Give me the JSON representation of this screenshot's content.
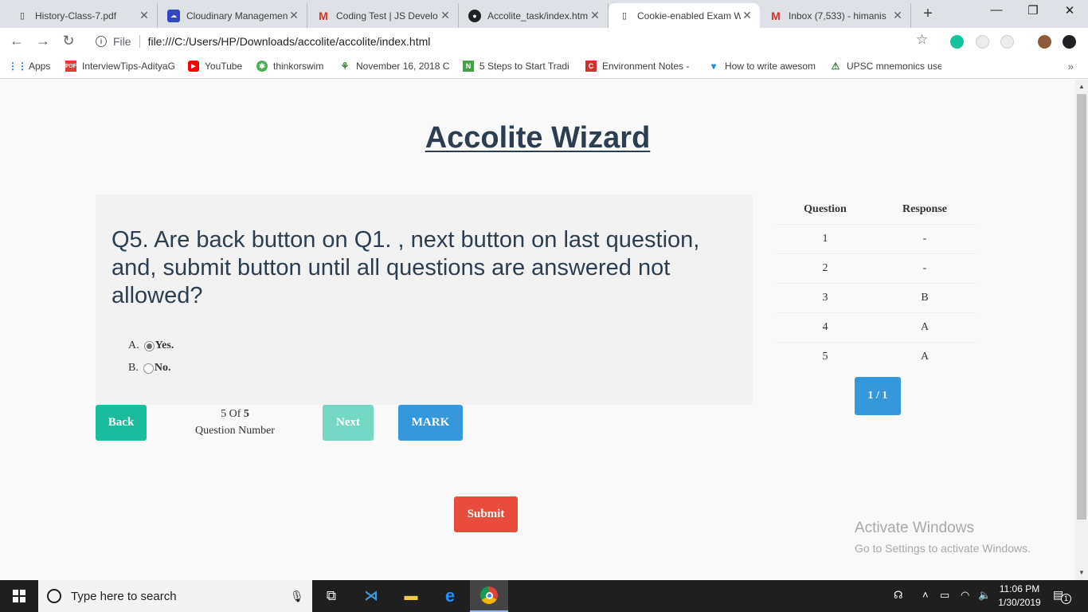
{
  "browser": {
    "tabs": [
      {
        "title": "History-Class-7.pdf",
        "icon": "document-icon"
      },
      {
        "title": "Cloudinary Managemen",
        "icon": "cloudinary-icon"
      },
      {
        "title": "Coding Test | JS Develo",
        "icon": "gmail-icon"
      },
      {
        "title": "Accolite_task/index.htm",
        "icon": "github-icon"
      },
      {
        "title": "Cookie-enabled Exam W",
        "icon": "document-icon"
      },
      {
        "title": "Inbox (7,533) - himanis",
        "icon": "gmail-icon"
      }
    ],
    "scheme": "File",
    "url": "file:///C:/Users/HP/Downloads/accolite/accolite/index.html",
    "bookmarks": [
      {
        "label": "Apps",
        "icon": "apps-grid-icon"
      },
      {
        "label": "InterviewTips-AdityaG",
        "icon": "pdf-icon"
      },
      {
        "label": "YouTube",
        "icon": "youtube-icon"
      },
      {
        "label": "thinkorswim",
        "icon": "thinkorswim-icon"
      },
      {
        "label": "November 16, 2018 C",
        "icon": "plant-icon"
      },
      {
        "label": "5 Steps to Start Tradi",
        "icon": "n-icon"
      },
      {
        "label": "Environment Notes -",
        "icon": "c-icon"
      },
      {
        "label": "How to write awesom",
        "icon": "bookmark-icon"
      },
      {
        "label": "UPSC mnemonics use",
        "icon": "tree-icon"
      }
    ],
    "bookmarks_more": "»"
  },
  "wizard": {
    "title": "Accolite Wizard",
    "question": "Q5. Are back button on Q1. , next button on last question, and, submit button until all questions are answered not allowed?",
    "options": [
      {
        "letter": "A.",
        "text": "Yes.",
        "selected": true
      },
      {
        "letter": "B.",
        "text": "No.",
        "selected": false
      }
    ],
    "buttons": {
      "back": "Back",
      "next": "Next",
      "mark": "MARK",
      "submit": "Submit"
    },
    "counter": {
      "current": "5",
      "of": "Of",
      "total": "5",
      "label": "Question Number"
    },
    "colors": {
      "back": "#1abc9c",
      "next": "#76d7c4",
      "mark": "#3498db",
      "submit": "#e74c3c",
      "title": "#2c3e50"
    }
  },
  "responses": {
    "headers": [
      "Question",
      "Response"
    ],
    "rows": [
      [
        "1",
        "-"
      ],
      [
        "2",
        "-"
      ],
      [
        "3",
        "B"
      ],
      [
        "4",
        "A"
      ],
      [
        "5",
        "A"
      ]
    ],
    "page": "1 / 1"
  },
  "watermark": {
    "line1": "Activate Windows",
    "line2": "Go to Settings to activate Windows."
  },
  "taskbar": {
    "search_placeholder": "Type here to search",
    "time": "11:06 PM",
    "date": "1/30/2019",
    "notifications": "1"
  }
}
